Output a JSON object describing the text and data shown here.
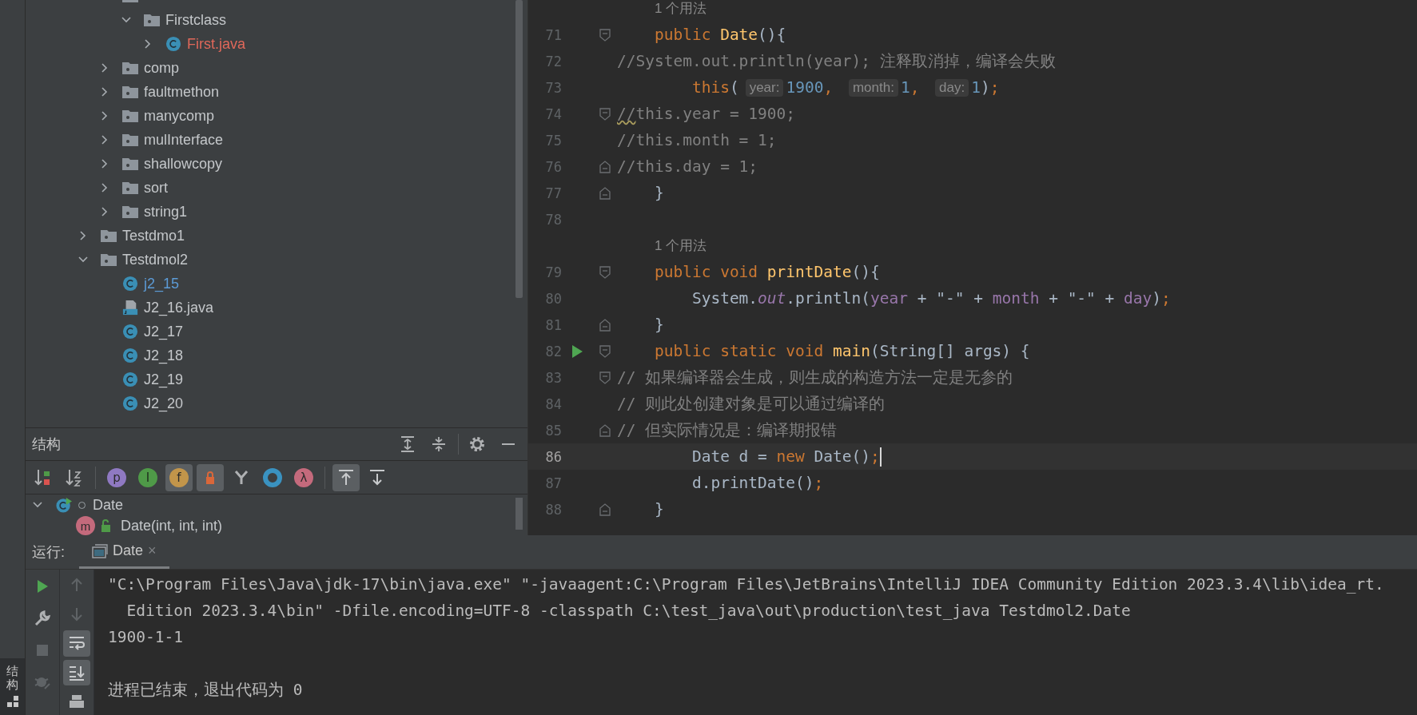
{
  "tool_strip": {
    "label": "结构",
    "selected": true
  },
  "project_tree": [
    {
      "kind": "folder",
      "children": [
        {
          "kind": "folder",
          "children": [
            {
              "label": "Firstclass",
              "kind": "folder",
              "expanded": true,
              "children": [
                {
                  "label": "First.java",
                  "kind": "class",
                  "expanded": false,
                  "color": "#e0685a"
                }
              ]
            }
          ]
        },
        {
          "label": "comp",
          "kind": "folder",
          "expanded": false
        },
        {
          "label": "faultmethon",
          "kind": "folder",
          "expanded": false
        },
        {
          "label": "manycomp",
          "kind": "folder",
          "expanded": false
        },
        {
          "label": "mulInterface",
          "kind": "folder",
          "expanded": false
        },
        {
          "label": "shallowcopy",
          "kind": "folder",
          "expanded": false
        },
        {
          "label": "sort",
          "kind": "folder",
          "expanded": false
        },
        {
          "label": "string1",
          "kind": "folder",
          "expanded": false
        }
      ]
    },
    {
      "label": "Testdmo1",
      "kind": "folder",
      "expanded": false
    },
    {
      "label": "Testdmol2",
      "kind": "folder",
      "expanded": true,
      "children": [
        {
          "label": "j2_15",
          "kind": "class",
          "color": "#5c9bd6"
        },
        {
          "label": "J2_16.java",
          "kind": "java-file"
        },
        {
          "label": "J2_17",
          "kind": "class"
        },
        {
          "label": "J2_18",
          "kind": "class"
        },
        {
          "label": "J2_19",
          "kind": "class"
        },
        {
          "label": "J2_20",
          "kind": "class"
        }
      ]
    }
  ],
  "structure": {
    "title": "结构",
    "header_buttons": [
      {
        "kind": "expand-all"
      },
      {
        "kind": "collapse-all"
      },
      {
        "kind": "settings"
      },
      {
        "kind": "minimize"
      }
    ],
    "toolbar_groups": [
      [
        {
          "kind": "sort-visibility",
          "selected": false
        },
        {
          "kind": "sort-alpha",
          "selected": false
        }
      ],
      [
        {
          "kind": "letter",
          "glyph": "p",
          "color": "#8f79c2",
          "selected": false
        },
        {
          "kind": "letter-arrow",
          "glyph": "I",
          "color": "#4f9a48",
          "selected": false
        },
        {
          "kind": "letter",
          "glyph": "f",
          "color": "#c2954a",
          "selected": true
        },
        {
          "kind": "lock",
          "selected": true
        },
        {
          "kind": "fork",
          "selected": false
        },
        {
          "kind": "ring",
          "color": "#3a92c0",
          "selected": false
        },
        {
          "kind": "letter",
          "glyph": "λ",
          "color": "#c46a7c",
          "selected": false
        }
      ],
      [
        {
          "kind": "show-up",
          "selected": true
        },
        {
          "kind": "show-down",
          "selected": false
        }
      ]
    ],
    "tree": [
      {
        "label": "Date",
        "kind": "class",
        "expanded": true,
        "children": [
          {
            "label": "Date(int, int, int)",
            "kind": "method",
            "glyph": "m"
          }
        ]
      }
    ]
  },
  "editor": {
    "lines": [
      {
        "kind": "usage",
        "text": "1 个用法"
      },
      {
        "kind": "code",
        "number": "71",
        "fold_start": true,
        "segments": [
          {
            "kind": "kw",
            "text": "    public "
          },
          {
            "kind": "fn",
            "text": "Date"
          },
          {
            "kind": "plain",
            "text": "(){"
          }
        ]
      },
      {
        "kind": "code",
        "number": "72",
        "segments": [
          {
            "kind": "cm",
            "text": "//System.out.println(year); 注释取消掉，编译会失败"
          }
        ]
      },
      {
        "kind": "code",
        "number": "73",
        "segments": [
          {
            "kind": "kw",
            "text": "        this"
          },
          {
            "kind": "plain",
            "text": "("
          },
          {
            "kind": "hint",
            "text": "year:"
          },
          {
            "kind": "num",
            "text": "1900"
          },
          {
            "kind": "kw",
            "text": ", "
          },
          {
            "kind": "hint",
            "text": "month:"
          },
          {
            "kind": "num",
            "text": "1"
          },
          {
            "kind": "kw",
            "text": ", "
          },
          {
            "kind": "hint",
            "text": "day:"
          },
          {
            "kind": "num",
            "text": "1"
          },
          {
            "kind": "plain",
            "text": ")"
          },
          {
            "kind": "kw",
            "text": ";"
          }
        ]
      },
      {
        "kind": "code",
        "number": "74",
        "fold_start": true,
        "segments": [
          {
            "kind": "typo",
            "text": "//"
          },
          {
            "kind": "cm",
            "text": "this.year = 1900;"
          }
        ]
      },
      {
        "kind": "code",
        "number": "75",
        "segments": [
          {
            "kind": "cm",
            "text": "//this.month = 1;"
          }
        ]
      },
      {
        "kind": "code",
        "number": "76",
        "fold_end": true,
        "segments": [
          {
            "kind": "cm",
            "text": "//this.day = 1;"
          }
        ]
      },
      {
        "kind": "code",
        "number": "77",
        "fold_end": true,
        "segments": [
          {
            "kind": "plain",
            "text": "    }"
          }
        ]
      },
      {
        "kind": "code",
        "number": "78"
      },
      {
        "kind": "usage",
        "text": "1 个用法"
      },
      {
        "kind": "code",
        "number": "79",
        "fold_start": true,
        "segments": [
          {
            "kind": "kw",
            "text": "    public void "
          },
          {
            "kind": "fn",
            "text": "printDate"
          },
          {
            "kind": "plain",
            "text": "(){"
          }
        ]
      },
      {
        "kind": "code",
        "number": "80",
        "segments": [
          {
            "kind": "plain",
            "text": "        System."
          },
          {
            "kind": "field-static",
            "text": "out"
          },
          {
            "kind": "plain",
            "text": ".println("
          },
          {
            "kind": "field",
            "text": "year"
          },
          {
            "kind": "plain",
            "text": " + "
          },
          {
            "kind": "str",
            "text": "\"-\""
          },
          {
            "kind": "plain",
            "text": " + "
          },
          {
            "kind": "field",
            "text": "month"
          },
          {
            "kind": "plain",
            "text": " + "
          },
          {
            "kind": "str",
            "text": "\"-\""
          },
          {
            "kind": "plain",
            "text": " + "
          },
          {
            "kind": "field",
            "text": "day"
          },
          {
            "kind": "plain",
            "text": ")"
          },
          {
            "kind": "kw",
            "text": ";"
          }
        ]
      },
      {
        "kind": "code",
        "number": "81",
        "fold_end": true,
        "segments": [
          {
            "kind": "plain",
            "text": "    }"
          }
        ]
      },
      {
        "kind": "code",
        "number": "82",
        "fold_start": true,
        "run": true,
        "segments": [
          {
            "kind": "kw",
            "text": "    public static void "
          },
          {
            "kind": "fn",
            "text": "main"
          },
          {
            "kind": "plain",
            "text": "(String[] args) {"
          }
        ]
      },
      {
        "kind": "code",
        "number": "83",
        "fold_start": true,
        "segments": [
          {
            "kind": "cm",
            "text": "// 如果编译器会生成，则生成的构造方法一定是无参的"
          }
        ]
      },
      {
        "kind": "code",
        "number": "84",
        "segments": [
          {
            "kind": "cm",
            "text": "// 则此处创建对象是可以通过编译的"
          }
        ]
      },
      {
        "kind": "code",
        "number": "85",
        "fold_end": true,
        "segments": [
          {
            "kind": "cm",
            "text": "// 但实际情况是：编译期报错"
          }
        ]
      },
      {
        "kind": "code",
        "number": "86",
        "current": true,
        "segments": [
          {
            "kind": "plain",
            "text": "        Date d = "
          },
          {
            "kind": "kw",
            "text": "new "
          },
          {
            "kind": "plain",
            "text": "Date()"
          },
          {
            "kind": "kw",
            "text": ";"
          }
        ]
      },
      {
        "kind": "code",
        "number": "87",
        "segments": [
          {
            "kind": "plain",
            "text": "        d.printDate()"
          },
          {
            "kind": "kw",
            "text": ";"
          }
        ]
      },
      {
        "kind": "code",
        "number": "88",
        "fold_end": true,
        "segments": [
          {
            "kind": "plain",
            "text": "    }"
          }
        ]
      }
    ]
  },
  "run": {
    "label": "运行:",
    "tabs": [
      {
        "label": "Date",
        "selected": true,
        "close": "×"
      }
    ],
    "toolbar_left": [
      {
        "kind": "run",
        "disabled": false
      },
      {
        "kind": "wrench",
        "disabled": false
      },
      {
        "kind": "stop",
        "disabled": true
      },
      {
        "kind": "debug",
        "disabled": true
      }
    ],
    "toolbar_right": [
      {
        "kind": "up",
        "selected": false
      },
      {
        "kind": "down",
        "selected": false
      },
      {
        "kind": "soft-wrap",
        "selected": true
      },
      {
        "kind": "scroll-end",
        "selected": true
      },
      {
        "kind": "print",
        "selected": false
      }
    ],
    "console": [
      {
        "kind": "output",
        "text": "\"C:\\Program Files\\Java\\jdk-17\\bin\\java.exe\" \"-javaagent:C:\\Program Files\\JetBrains\\IntelliJ IDEA Community Edition 2023.3.4\\lib\\idea_rt."
      },
      {
        "kind": "output",
        "text": "  Edition 2023.3.4\\bin\" -Dfile.encoding=UTF-8 -classpath C:\\test_java\\out\\production\\test_java Testdmol2.Date"
      },
      {
        "kind": "output",
        "text": "1900-1-1"
      },
      {
        "kind": "blank"
      },
      {
        "kind": "output",
        "text": "进程已结束，退出代码为 0"
      }
    ]
  }
}
